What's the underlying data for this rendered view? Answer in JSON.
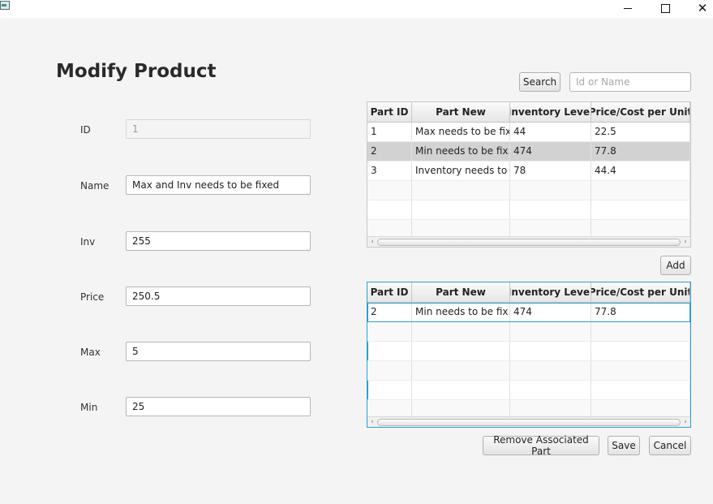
{
  "window": {
    "title_controls": {
      "minimize": "—",
      "maximize": "☐",
      "close": "✕"
    }
  },
  "page_title": "Modify Product",
  "form": {
    "id": {
      "label": "ID",
      "value": "1"
    },
    "name": {
      "label": "Name",
      "value": "Max and Inv needs to be fixed"
    },
    "inv": {
      "label": "Inv",
      "value": "255"
    },
    "price": {
      "label": "Price",
      "value": "250.5"
    },
    "max": {
      "label": "Max",
      "value": "5"
    },
    "min": {
      "label": "Min",
      "value": "25"
    }
  },
  "search": {
    "button_label": "Search",
    "placeholder": "Id or Name"
  },
  "columns": [
    "Part ID",
    "Part New",
    "Inventory Level",
    "Price/Cost per Unit"
  ],
  "parts_table": {
    "rows": [
      [
        "1",
        "Max needs to be fix...",
        "44",
        "22.5"
      ],
      [
        "2",
        "Min needs to be fix...",
        "474",
        "77.8"
      ],
      [
        "3",
        "Inventory needs to ...",
        "78",
        "44.4"
      ]
    ],
    "selected_row": 1
  },
  "add_button_label": "Add",
  "associated_table": {
    "rows": [
      [
        "2",
        "Min needs to be fix...",
        "474",
        "77.8"
      ]
    ],
    "focused_row": 0
  },
  "actions": {
    "remove_label": "Remove Associated Part",
    "save_label": "Save",
    "cancel_label": "Cancel"
  },
  "scroll_arrows": {
    "left": "‹",
    "right": "›"
  }
}
